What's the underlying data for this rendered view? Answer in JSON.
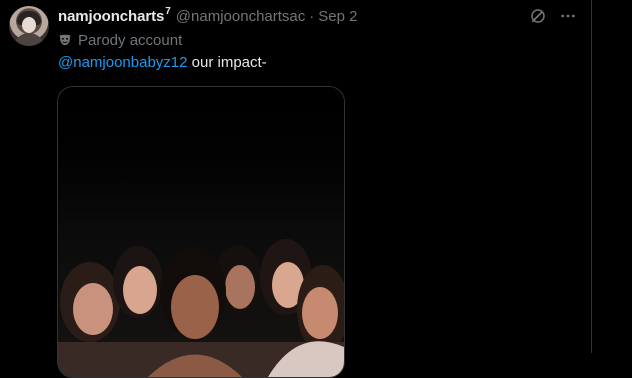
{
  "tweet": {
    "display_name": "namjooncharts",
    "name_superscript": "7",
    "handle": "@namjoonchartsac",
    "separator": "·",
    "date": "Sep 2",
    "parody_label": "Parody account",
    "mention": "@namjoonbabyz12",
    "text": " our impact-"
  },
  "icons": {
    "grok": "grok-icon",
    "more": "more-icon",
    "parody": "mask-icon"
  },
  "colors": {
    "background": "#000000",
    "text_primary": "#e7e9ea",
    "text_secondary": "#71767b",
    "link": "#1d9bf0",
    "border": "#2f3336"
  }
}
